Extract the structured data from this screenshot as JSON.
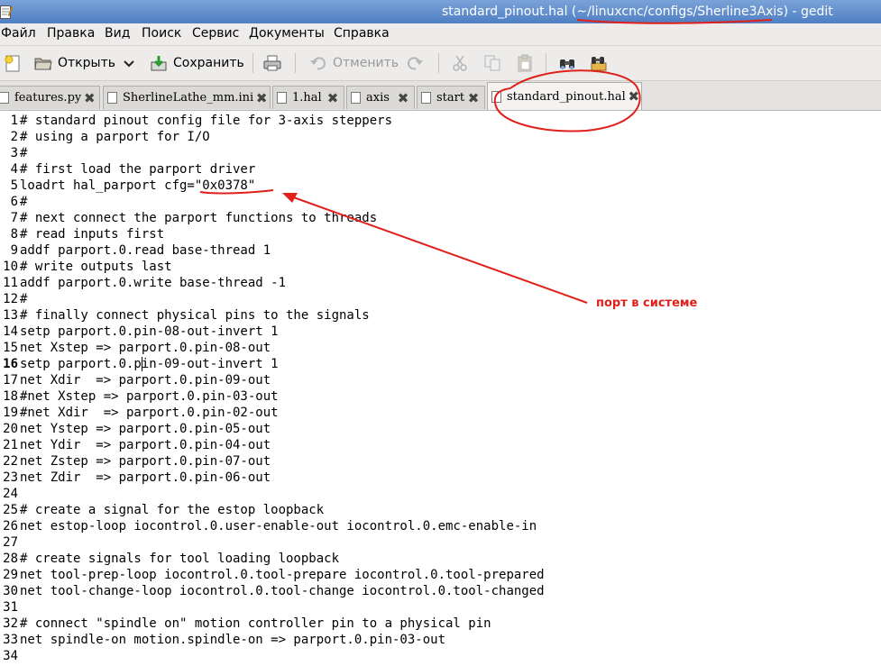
{
  "window": {
    "title": "standard_pinout.hal (~/linuxcnc/configs/Sherline3Axis) - gedit"
  },
  "menu": [
    {
      "label": "Файл"
    },
    {
      "label": "Правка"
    },
    {
      "label": "Вид"
    },
    {
      "label": "Поиск"
    },
    {
      "label": "Сервис"
    },
    {
      "label": "Документы"
    },
    {
      "label": "Справка"
    }
  ],
  "toolbar": {
    "open_label": "Открыть",
    "save_label": "Сохранить",
    "undo_label": "Отменить"
  },
  "tabs": [
    {
      "label": "features.py",
      "active": false
    },
    {
      "label": "SherlineLathe_mm.ini",
      "active": false
    },
    {
      "label": "1.hal",
      "active": false
    },
    {
      "label": "axis",
      "active": false
    },
    {
      "label": "start",
      "active": false
    },
    {
      "label": "standard_pinout.hal",
      "active": true
    }
  ],
  "editor": {
    "current_line": 16,
    "lines": [
      "# standard pinout config file for 3-axis steppers",
      "# using a parport for I/O",
      "#",
      "# first load the parport driver",
      "loadrt hal_parport cfg=\"0x0378\"",
      "#",
      "# next connect the parport functions to threads",
      "# read inputs first",
      "addf parport.0.read base-thread 1",
      "# write outputs last",
      "addf parport.0.write base-thread -1",
      "#",
      "# finally connect physical pins to the signals",
      "setp parport.0.pin-08-out-invert 1",
      "net Xstep => parport.0.pin-08-out",
      "setp parport.0.pin-09-out-invert 1",
      "net Xdir  => parport.0.pin-09-out",
      "#net Xstep => parport.0.pin-03-out",
      "#net Xdir  => parport.0.pin-02-out",
      "net Ystep => parport.0.pin-05-out",
      "net Ydir  => parport.0.pin-04-out",
      "net Zstep => parport.0.pin-07-out",
      "net Zdir  => parport.0.pin-06-out",
      "",
      "# create a signal for the estop loopback",
      "net estop-loop iocontrol.0.user-enable-out iocontrol.0.emc-enable-in",
      "",
      "# create signals for tool loading loopback",
      "net tool-prep-loop iocontrol.0.tool-prepare iocontrol.0.tool-prepared",
      "net tool-change-loop iocontrol.0.tool-change iocontrol.0.tool-changed",
      "",
      "# connect \"spindle on\" motion controller pin to a physical pin",
      "net spindle-on motion.spindle-on => parport.0.pin-03-out",
      ""
    ]
  },
  "annotation": {
    "label": "порт в системе",
    "color": "#e0201b"
  }
}
